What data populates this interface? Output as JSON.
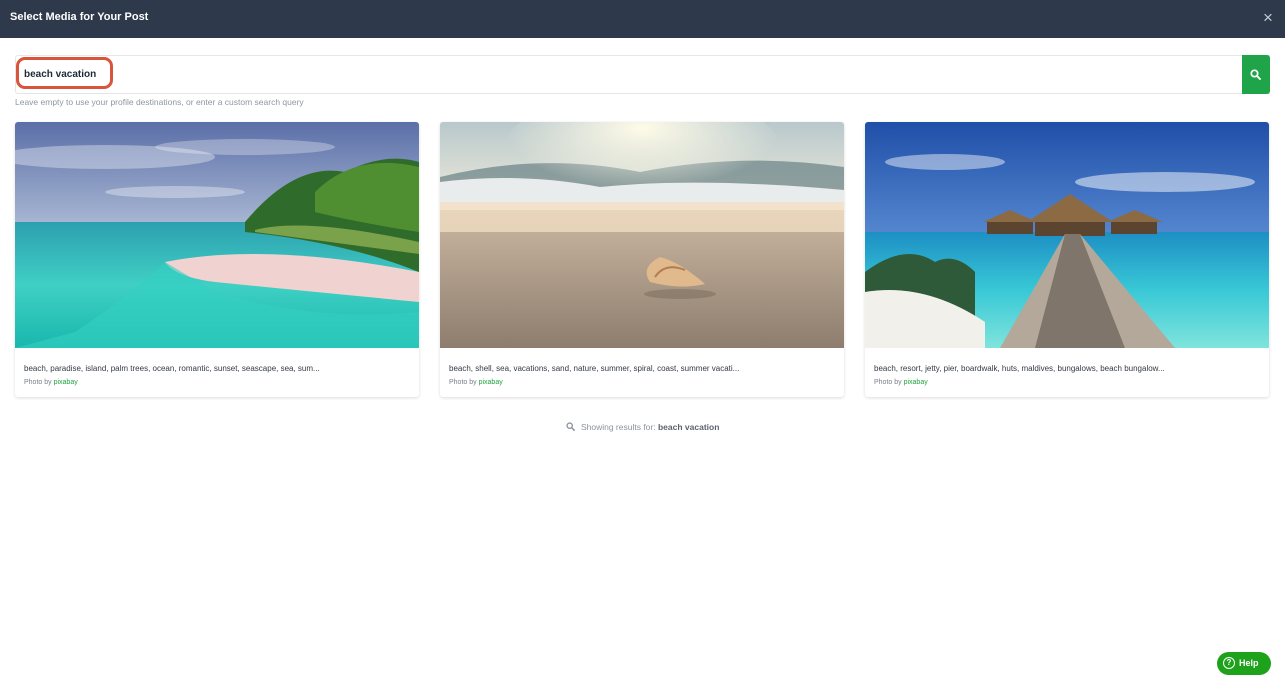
{
  "modal": {
    "title": "Select Media for Your Post",
    "close_glyph": "×"
  },
  "search": {
    "value": "beach vacation",
    "button_icon": "search-icon",
    "hint": "Leave empty to use your profile destinations, or enter a custom search query"
  },
  "results": [
    {
      "tags": "beach, paradise, island, palm trees, ocean, romantic, sunset, seascape, sea, sum...",
      "credit_prefix": "Photo by",
      "credit_source": "pixabay"
    },
    {
      "tags": "beach, shell, sea, vacations, sand, nature, summer, spiral, coast, summer vacati...",
      "credit_prefix": "Photo by",
      "credit_source": "pixabay"
    },
    {
      "tags": "beach, resort, jetty, pier, boardwalk, huts, maldives, bungalows, beach bungalow...",
      "credit_prefix": "Photo by",
      "credit_source": "pixabay"
    }
  ],
  "footer": {
    "icon": "search-icon",
    "prefix": "Showing results for:",
    "query": "beach vacation"
  },
  "help": {
    "icon": "question-circle-icon",
    "glyph": "?",
    "label": "Help"
  },
  "colors": {
    "header_bg": "#2e3a4b",
    "accent_green": "#20a44a",
    "highlight_red": "#d8553b"
  }
}
